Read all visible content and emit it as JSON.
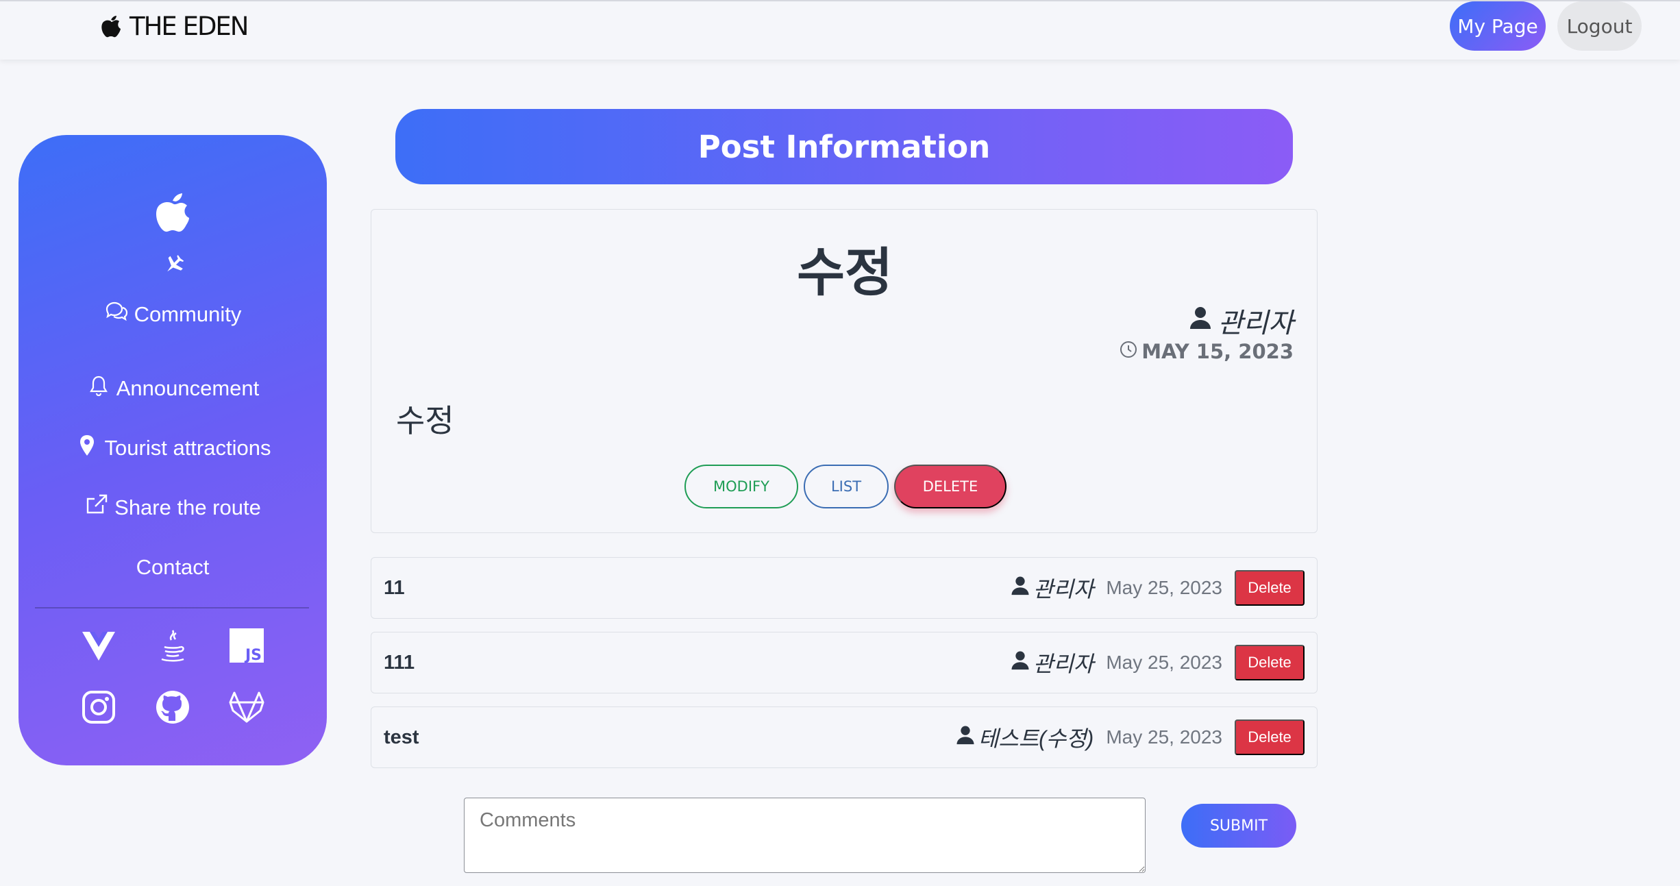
{
  "nav": {
    "brand": "THE EDEN",
    "my_page": "My Page",
    "logout": "Logout"
  },
  "sidebar": {
    "items": [
      {
        "label": "",
        "icon": "plane-icon"
      },
      {
        "label": "Community",
        "icon": "chat-icon"
      },
      {
        "label": "Announcement",
        "icon": "bell-icon"
      },
      {
        "label": "Tourist attractions",
        "icon": "map-pin-icon"
      },
      {
        "label": "Share the route",
        "icon": "share-icon"
      },
      {
        "label": "Contact",
        "icon": ""
      }
    ],
    "social_icons": [
      "vue-icon",
      "java-icon",
      "javascript-icon",
      "instagram-icon",
      "github-icon",
      "gitlab-icon"
    ],
    "js_badge": "JS"
  },
  "header": {
    "title": "Post Information"
  },
  "post": {
    "title": "수정",
    "author": "관리자",
    "date": "MAY 15, 2023",
    "body": "수정",
    "buttons": {
      "modify": "MODIFY",
      "list": "LIST",
      "delete": "DELETE"
    }
  },
  "comments": [
    {
      "text": "11",
      "author": "관리자",
      "date": "May 25, 2023",
      "delete_label": "Delete"
    },
    {
      "text": "111",
      "author": "관리자",
      "date": "May 25, 2023",
      "delete_label": "Delete"
    },
    {
      "text": "test",
      "author": "테스트(수정)",
      "date": "May 25, 2023",
      "delete_label": "Delete"
    }
  ],
  "comment_form": {
    "placeholder": "Comments",
    "submit": "SUBMIT"
  },
  "colors": {
    "gradient_start": "#3d6ef7",
    "gradient_end": "#8b5cf6",
    "danger": "#dc3545",
    "modify": "#1f9d55",
    "list": "#3b6db3"
  }
}
